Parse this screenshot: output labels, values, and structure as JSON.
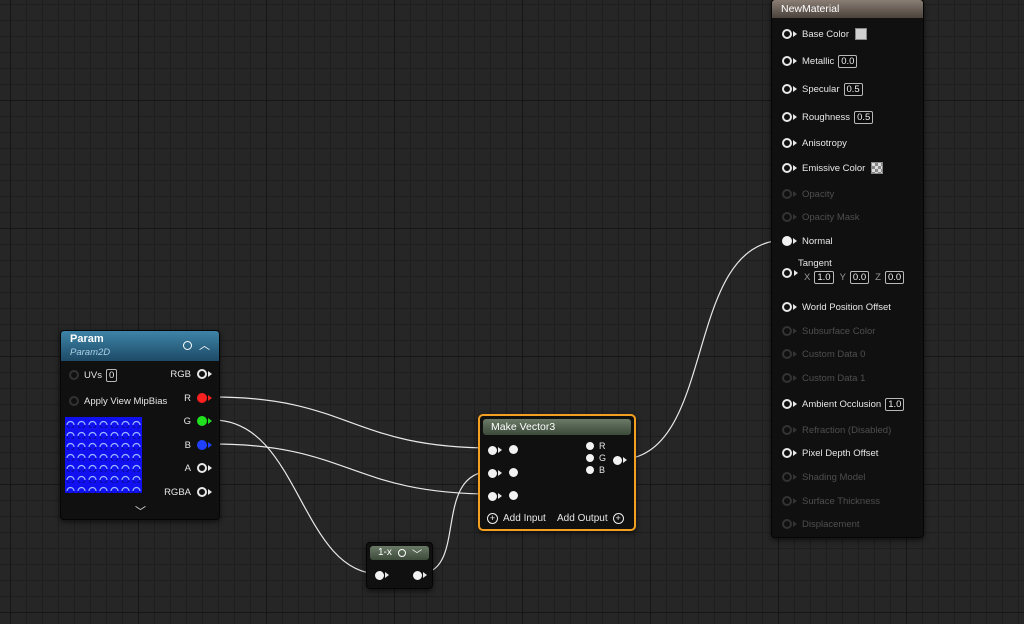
{
  "param_node": {
    "title": "Param",
    "subtitle": "Param2D",
    "inputs": [
      {
        "label": "UVs",
        "value": "0"
      },
      {
        "label": "Apply View MipBias"
      }
    ],
    "outputs": [
      "RGB",
      "R",
      "G",
      "B",
      "A",
      "RGBA"
    ],
    "output_colors": {
      "R": "#ff2020",
      "G": "#20e020",
      "B": "#2040ff"
    }
  },
  "make_vector3": {
    "title": "Make Vector3",
    "outputs": [
      "R",
      "G",
      "B"
    ],
    "add_input": "Add Input",
    "add_output": "Add Output"
  },
  "one_minus": {
    "title": "1-x"
  },
  "material": {
    "title": "NewMaterial",
    "pins": [
      {
        "label": "Base Color",
        "kind": "swatch"
      },
      {
        "label": "Metallic",
        "value": "0.0"
      },
      {
        "label": "Specular",
        "value": "0.5"
      },
      {
        "label": "Roughness",
        "value": "0.5"
      },
      {
        "label": "Anisotropy"
      },
      {
        "label": "Emissive Color",
        "kind": "checker"
      },
      {
        "label": "Opacity",
        "disabled": true
      },
      {
        "label": "Opacity Mask",
        "disabled": true
      },
      {
        "label": "Normal",
        "connected": true
      },
      {
        "label": "Tangent",
        "x": "1.0",
        "y": "0.0",
        "z": "0.0"
      },
      {
        "label": "World Position Offset"
      },
      {
        "label": "Subsurface Color",
        "disabled": true
      },
      {
        "label": "Custom Data 0",
        "disabled": true
      },
      {
        "label": "Custom Data 1",
        "disabled": true
      },
      {
        "label": "Ambient Occlusion",
        "value": "1.0"
      },
      {
        "label": "Refraction (Disabled)",
        "disabled": true
      },
      {
        "label": "Pixel Depth Offset"
      },
      {
        "label": "Shading Model",
        "disabled": true
      },
      {
        "label": "Surface Thickness",
        "disabled": true
      },
      {
        "label": "Displacement",
        "disabled": true
      }
    ],
    "tangent_axes": {
      "x": "X",
      "y": "Y",
      "z": "Z"
    },
    "base_color": "#d0d0d0"
  },
  "colors": {
    "grid_bg": "#262626",
    "selection_outline": "#f3a020",
    "param_header": "#2a6a90",
    "wire": "#e8e8e8",
    "texture_blue": "#1010f0"
  }
}
